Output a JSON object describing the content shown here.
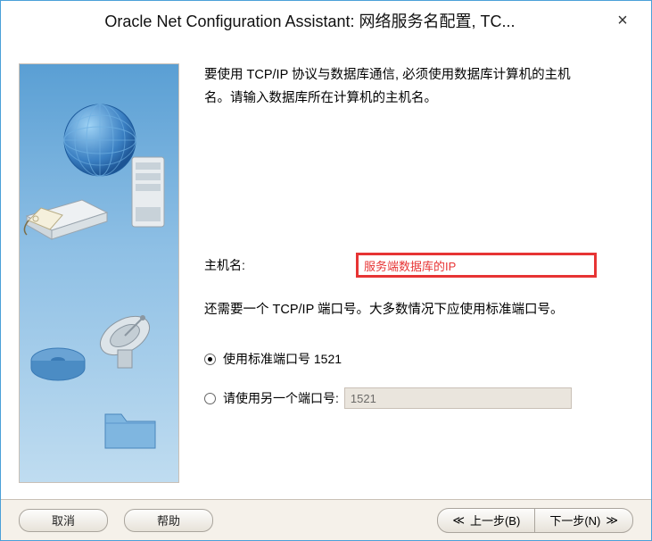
{
  "window": {
    "title": "Oracle Net Configuration Assistant: 网络服务名配置,  TC...",
    "close_glyph": "×"
  },
  "intro": {
    "line1": "要使用 TCP/IP 协议与数据库通信, 必须使用数据库计算机的主机",
    "line2": "名。请输入数据库所在计算机的主机名。"
  },
  "host": {
    "label": "主机名:",
    "value": "服务端数据库的IP"
  },
  "port": {
    "text": "还需要一个 TCP/IP 端口号。大多数情况下应使用标准端口号。",
    "option_standard": "使用标准端口号 1521",
    "option_custom": "请使用另一个端口号:",
    "custom_value": "1521",
    "selected": "standard"
  },
  "footer": {
    "cancel": "取消",
    "help": "帮助",
    "back_prefix": "上一步(",
    "back_key": "B",
    "back_suffix": ")",
    "next_prefix": "下一步(",
    "next_key": "N",
    "next_suffix": ")"
  }
}
